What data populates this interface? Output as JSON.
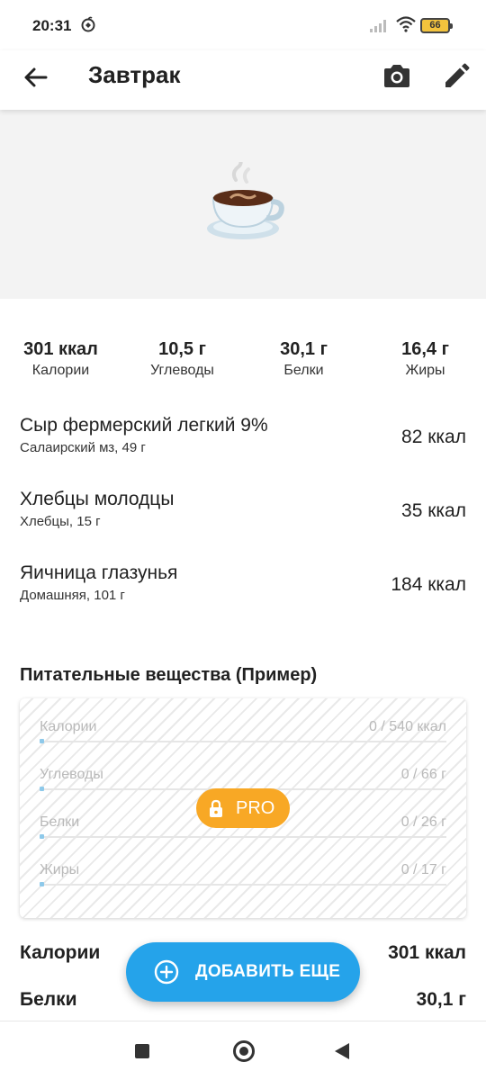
{
  "status_bar": {
    "time": "20:31",
    "battery": "66"
  },
  "app_bar": {
    "title": "Завтрак"
  },
  "summary": [
    {
      "value": "301 ккал",
      "label": "Калории"
    },
    {
      "value": "10,5 г",
      "label": "Углеводы"
    },
    {
      "value": "30,1 г",
      "label": "Белки"
    },
    {
      "value": "16,4 г",
      "label": "Жиры"
    }
  ],
  "foods": [
    {
      "name": "Сыр фермерский легкий 9%",
      "detail": "Салаирский мз, 49 г",
      "kcal": "82 ккал"
    },
    {
      "name": "Хлебцы молодцы",
      "detail": "Хлебцы, 15 г",
      "kcal": "35 ккал"
    },
    {
      "name": "Яичница глазунья",
      "detail": "Домашняя, 101 г",
      "kcal": "184 ккал"
    }
  ],
  "nutrients": {
    "title": "Питательные вещества (Пример)",
    "rows": [
      {
        "label": "Калории",
        "value": "0 / 540 ккал",
        "progress": 0
      },
      {
        "label": "Углеводы",
        "value": "0 / 66 г",
        "progress": 0
      },
      {
        "label": "Белки",
        "value": "0 / 26 г",
        "progress": 0
      },
      {
        "label": "Жиры",
        "value": "0 / 17 г",
        "progress": 0
      }
    ],
    "pro_label": "PRO"
  },
  "totals": [
    {
      "label": "Калории",
      "value": "301 ккал"
    },
    {
      "label": "Белки",
      "value": "30,1 г"
    }
  ],
  "fab": {
    "label": "ДОБАВИТЬ ЕЩЕ"
  },
  "colors": {
    "accent": "#25a3ea",
    "pro": "#f8a825",
    "progress": "#8ec9ea"
  }
}
